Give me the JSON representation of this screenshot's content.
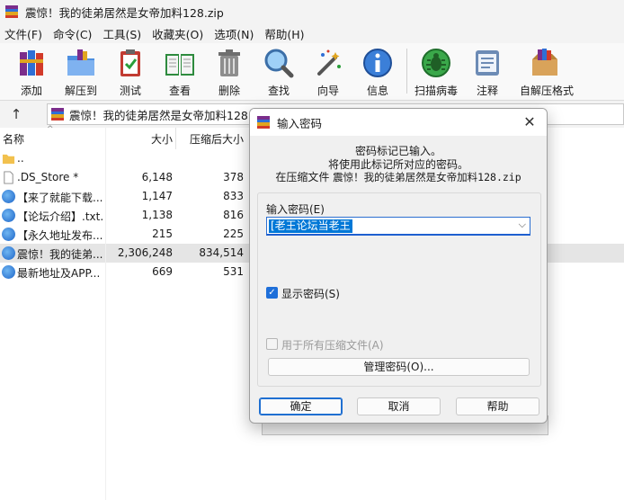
{
  "window": {
    "title": "震惊！我的徒弟居然是女帝加料128.zip"
  },
  "menu": [
    "文件(F)",
    "命令(C)",
    "工具(S)",
    "收藏夹(O)",
    "选项(N)",
    "帮助(H)"
  ],
  "toolbar": [
    {
      "label": "添加",
      "icon": "books-add-icon"
    },
    {
      "label": "解压到",
      "icon": "folder-extract-icon"
    },
    {
      "label": "测试",
      "icon": "clipboard-test-icon"
    },
    {
      "label": "查看",
      "icon": "open-book-icon"
    },
    {
      "label": "删除",
      "icon": "trash-icon"
    },
    {
      "label": "查找",
      "icon": "magnifier-icon"
    },
    {
      "label": "向导",
      "icon": "magic-wand-icon"
    },
    {
      "label": "信息",
      "icon": "info-icon"
    },
    {
      "label": "扫描病毒",
      "icon": "virus-scan-icon"
    },
    {
      "label": "注释",
      "icon": "comment-icon"
    },
    {
      "label": "自解压格式",
      "icon": "sfx-box-icon"
    }
  ],
  "address": {
    "path": "震惊！我的徒弟居然是女帝加料128.zi"
  },
  "columns": {
    "name": "名称",
    "size": "大小",
    "packed": "压缩后大小"
  },
  "files": [
    {
      "name": "..",
      "size": "",
      "packed": "",
      "type": "folder"
    },
    {
      "name": ".DS_Store *",
      "size": "6,148",
      "packed": "378",
      "type": "file"
    },
    {
      "name": "【来了就能下载...",
      "size": "1,147",
      "packed": "833",
      "type": "link"
    },
    {
      "name": "【论坛介绍】.txt...",
      "size": "1,138",
      "packed": "816",
      "type": "link"
    },
    {
      "name": "【永久地址发布...",
      "size": "215",
      "packed": "225",
      "type": "link"
    },
    {
      "name": "震惊！我的徒弟...",
      "size": "2,306,248",
      "packed": "834,514",
      "type": "link"
    },
    {
      "name": "最新地址及APP...",
      "size": "669",
      "packed": "531",
      "type": "link"
    }
  ],
  "dialog": {
    "title": "输入密码",
    "message_line1": "密码标记已输入。",
    "message_line2": "将使用此标记所对应的密码。",
    "message_line3_prefix": "在压缩文件 ",
    "message_line3_file": "震惊！我的徒弟居然是女帝加料128.zip",
    "password_label": "输入密码(E)",
    "password_value": "[老王论坛当老王",
    "show_password": "显示密码(S)",
    "use_for_all": "用于所有压缩文件(A)",
    "organize": "管理密码(O)...",
    "ok": "确定",
    "cancel": "取消",
    "help": "帮助"
  }
}
